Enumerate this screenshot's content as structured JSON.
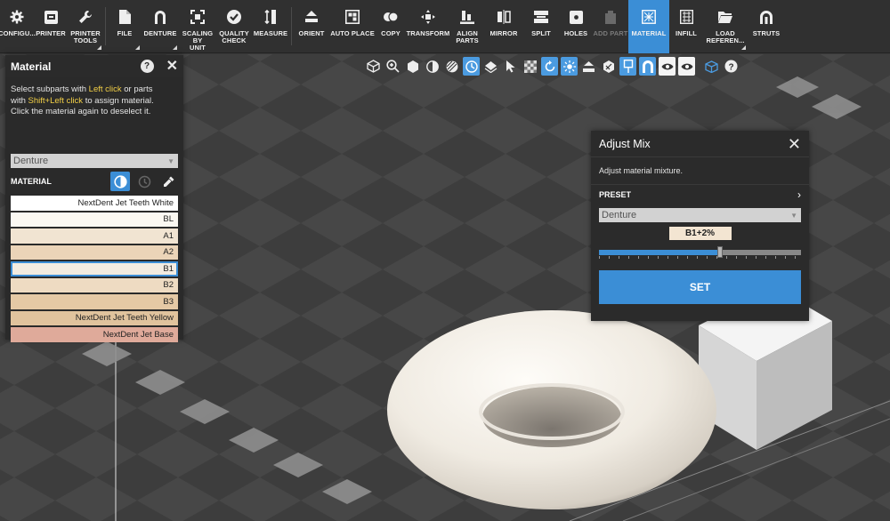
{
  "toolbar": {
    "items": [
      {
        "label": "CONFIGU...",
        "icon": "gear-icon"
      },
      {
        "label": "PRINTER",
        "icon": "printer-icon"
      },
      {
        "label": "PRINTER\nTOOLS",
        "icon": "wrench-icon"
      },
      {
        "label": "FILE",
        "icon": "file-icon"
      },
      {
        "label": "DENTURE",
        "icon": "denture-icon"
      },
      {
        "label": "SCALING BY\nUNIT",
        "icon": "scale-icon"
      },
      {
        "label": "QUALITY\nCHECK",
        "icon": "check-icon"
      },
      {
        "label": "MEASURE",
        "icon": "measure-icon"
      },
      {
        "label": "ORIENT",
        "icon": "orient-icon"
      },
      {
        "label": "AUTO PLACE",
        "icon": "auto-place-icon"
      },
      {
        "label": "COPY",
        "icon": "copy-icon"
      },
      {
        "label": "TRANSFORM",
        "icon": "transform-icon"
      },
      {
        "label": "ALIGN\nPARTS",
        "icon": "align-icon"
      },
      {
        "label": "MIRROR",
        "icon": "mirror-icon"
      },
      {
        "label": "SPLIT",
        "icon": "split-icon"
      },
      {
        "label": "HOLES",
        "icon": "holes-icon"
      },
      {
        "label": "ADD PART",
        "icon": "add-part-icon"
      },
      {
        "label": "MATERIAL",
        "icon": "material-icon"
      },
      {
        "label": "INFILL",
        "icon": "infill-icon"
      },
      {
        "label": "LOAD\nREFEREN...",
        "icon": "folder-icon"
      },
      {
        "label": "STRUTS",
        "icon": "struts-icon"
      }
    ]
  },
  "material_panel": {
    "title": "Material",
    "help_line1_a": "Select subparts with ",
    "help_line1_hl": "Left click",
    "help_line1_b": " or parts",
    "help_line2_a": "with ",
    "help_line2_hl": "Shift+Left click",
    "help_line2_b": " to assign material.",
    "help_line3": "Click the material again to deselect it.",
    "dropdown_value": "Denture",
    "section_label": "MATERIAL",
    "materials": [
      {
        "name": "NextDent Jet Teeth White",
        "color": "#ffffff"
      },
      {
        "name": "BL",
        "color": "#fbf8f2"
      },
      {
        "name": "A1",
        "color": "#f1e4d2"
      },
      {
        "name": "A2",
        "color": "#ebd4b8"
      },
      {
        "name": "B1",
        "color": "#f3ece1"
      },
      {
        "name": "B2",
        "color": "#eedbc2"
      },
      {
        "name": "B3",
        "color": "#e5c9a5"
      },
      {
        "name": "NextDent Jet Teeth Yellow",
        "color": "#e0c39d"
      },
      {
        "name": "NextDent Jet Base",
        "color": "#dfaa9a"
      }
    ],
    "selected_index": 4
  },
  "adjust_mix": {
    "title": "Adjust Mix",
    "description": "Adjust material mixture.",
    "preset_label": "PRESET",
    "preset_value": "Denture",
    "mix_value": "B1+2%",
    "slider_fraction": 0.6,
    "set_label": "SET"
  },
  "colors": {
    "accent": "#3b8ed6",
    "toolbar_bg": "#303030",
    "panel_bg": "#2a2a2a",
    "highlight_text": "#f2cf46"
  }
}
